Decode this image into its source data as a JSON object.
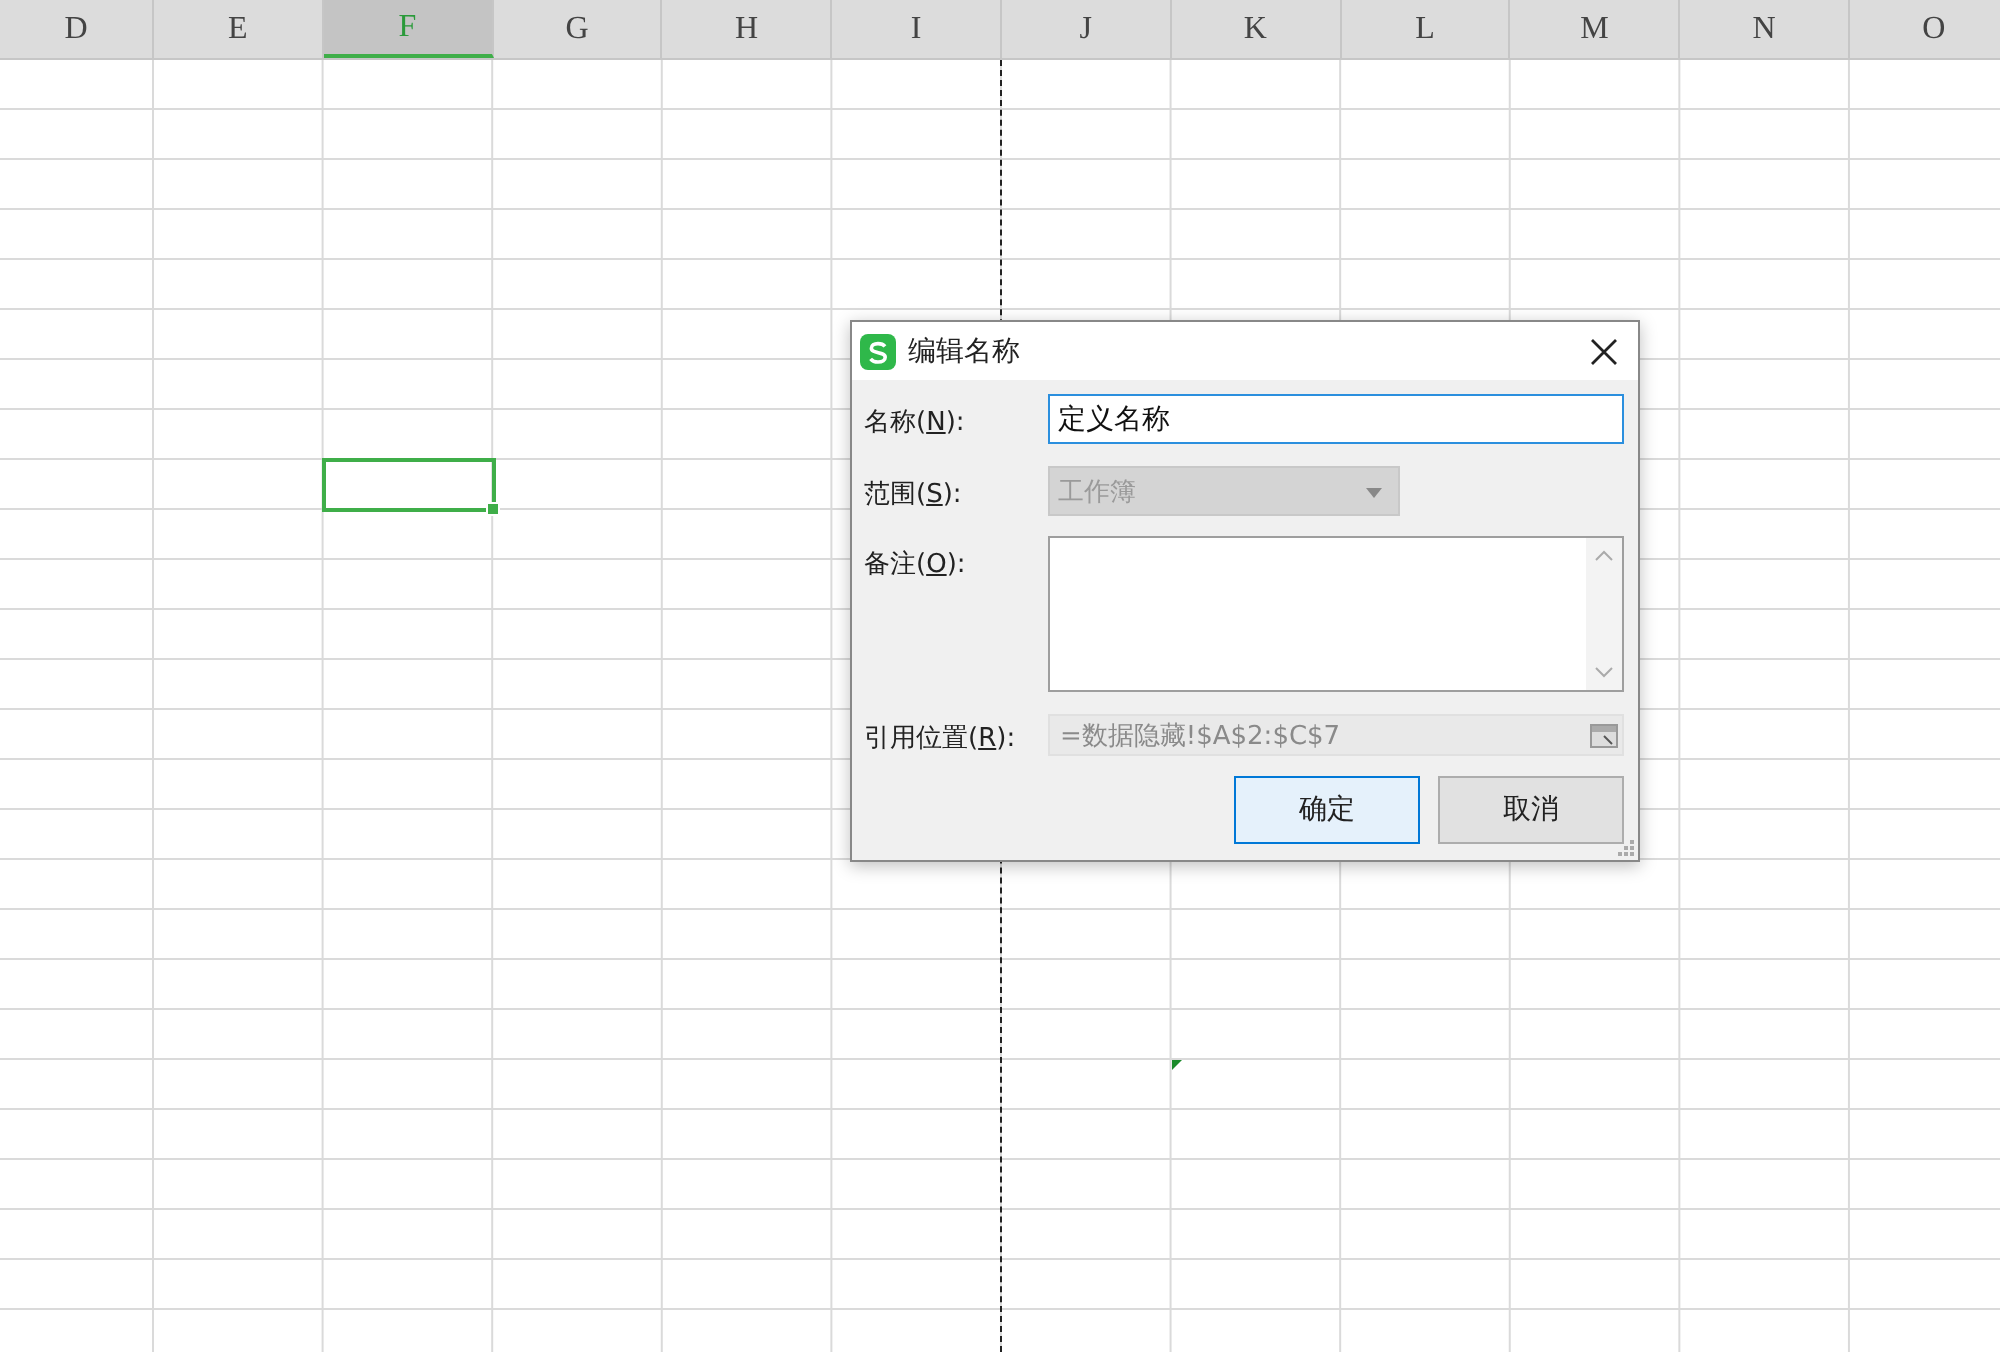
{
  "sheet": {
    "columns": [
      {
        "label": "D",
        "selected": false
      },
      {
        "label": "E",
        "selected": false
      },
      {
        "label": "F",
        "selected": true
      },
      {
        "label": "G",
        "selected": false
      },
      {
        "label": "H",
        "selected": false
      },
      {
        "label": "I",
        "selected": false
      },
      {
        "label": "J",
        "selected": false
      },
      {
        "label": "K",
        "selected": false
      },
      {
        "label": "L",
        "selected": false
      },
      {
        "label": "M",
        "selected": false
      },
      {
        "label": "N",
        "selected": false
      },
      {
        "label": "O",
        "selected": false
      }
    ]
  },
  "dialog": {
    "title": "编辑名称",
    "fields": [
      {
        "kind": "input",
        "label": "名称(",
        "key": "N",
        "suffix": "):",
        "value": "定义名称",
        "focused": true,
        "disabled": false
      },
      {
        "kind": "select",
        "label": "范围(",
        "key": "S",
        "suffix": "):",
        "value": "工作簿",
        "disabled": true
      },
      {
        "kind": "textarea",
        "label": "备注(",
        "key": "O",
        "suffix": "):",
        "disabled": false
      },
      {
        "kind": "reference",
        "label": "引用位置(",
        "key": "R",
        "suffix": "):",
        "value": "=数据隐藏!$A$2:$C$7",
        "disabled": true
      }
    ],
    "buttons": [
      {
        "label": "确定",
        "default": true
      },
      {
        "label": "取消",
        "default": false
      }
    ]
  }
}
